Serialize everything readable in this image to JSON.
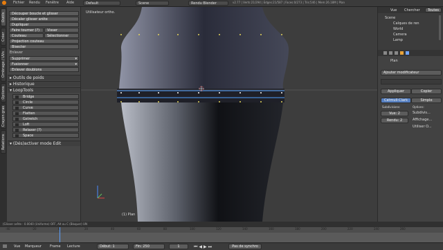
{
  "menubar": {
    "items": [
      "Fichier",
      "Rendu",
      "Fenêtre",
      "Aide"
    ],
    "layout": "Default",
    "scene": "Scene",
    "engine": "Rendu Blender",
    "stats": "v2.77 | Verts:21/294 | Edges:21/587 | Faces:0/273 | Tris:546 | Mem:26.18M | Plan"
  },
  "tabs": [
    "Outils",
    "Créer",
    "Ombrage / UVs",
    "Options",
    "Crayon gras",
    "Relations"
  ],
  "shelf": {
    "buttons": [
      "Découper boucle et glisser",
      "Décaler glisser arête",
      "Dupliquer"
    ],
    "row1": [
      "Faire tourner (?)",
      "Visser"
    ],
    "row2": [
      "Couteau",
      "Sélectionner"
    ],
    "buttons2": [
      "Projection couteau",
      "Bisecter"
    ],
    "remove_label": "Enlever",
    "delete_label": "Supprimer",
    "merge_label": "Fusionner",
    "remove_doubles": "Enlever doublons",
    "panels": [
      "Outils de poids",
      "Historique",
      "LoopTools"
    ],
    "loop_items": [
      "Bridge",
      "Circle",
      "Curve",
      "Flatten",
      "Gstretch",
      "Loft",
      "Relaxer (?)",
      "Space"
    ],
    "operator": "(Dés)activer mode Edit"
  },
  "viewport": {
    "view_label": "Utilisateur ortho.",
    "object_label": "(1) Plan"
  },
  "outliner": {
    "tabs": [
      "Vue",
      "Chercher",
      "Toutes"
    ],
    "items": [
      "Scene",
      "Calques de ren",
      "World",
      "Camera",
      "Lamp"
    ]
  },
  "properties": {
    "object": "Plan",
    "add_modifier": "Ajouter modificateur",
    "apply": "Appliquer",
    "copy": "Copier",
    "catmull": "Catmull-Clark",
    "simple": "Simple",
    "subdivisions": "Subdivisions:",
    "view_label": "Vue:",
    "view_val": "2",
    "render_label": "Rendu:",
    "render_val": "2",
    "options": "Options:",
    "opt1": "Subdivis...",
    "opt2": "Affichage...",
    "opt3": "Utiliser O..."
  },
  "status": "(Glisser arête : 0.0040 (Uniforme)    OFF, Alt ou C (Bloquer)    UN",
  "timeline": {
    "ticks": [
      "-40",
      "-20",
      "0",
      "20",
      "40",
      "60",
      "80",
      "100",
      "120",
      "140",
      "160",
      "180",
      "200",
      "220",
      "240",
      "260"
    ],
    "footer": [
      "Vue",
      "Marqueur",
      "Frame",
      "Lecture"
    ],
    "start_label": "Début:",
    "start": "1",
    "end_label": "Fin:",
    "end": "250",
    "current": "1",
    "sync": "Pas de synchro"
  }
}
